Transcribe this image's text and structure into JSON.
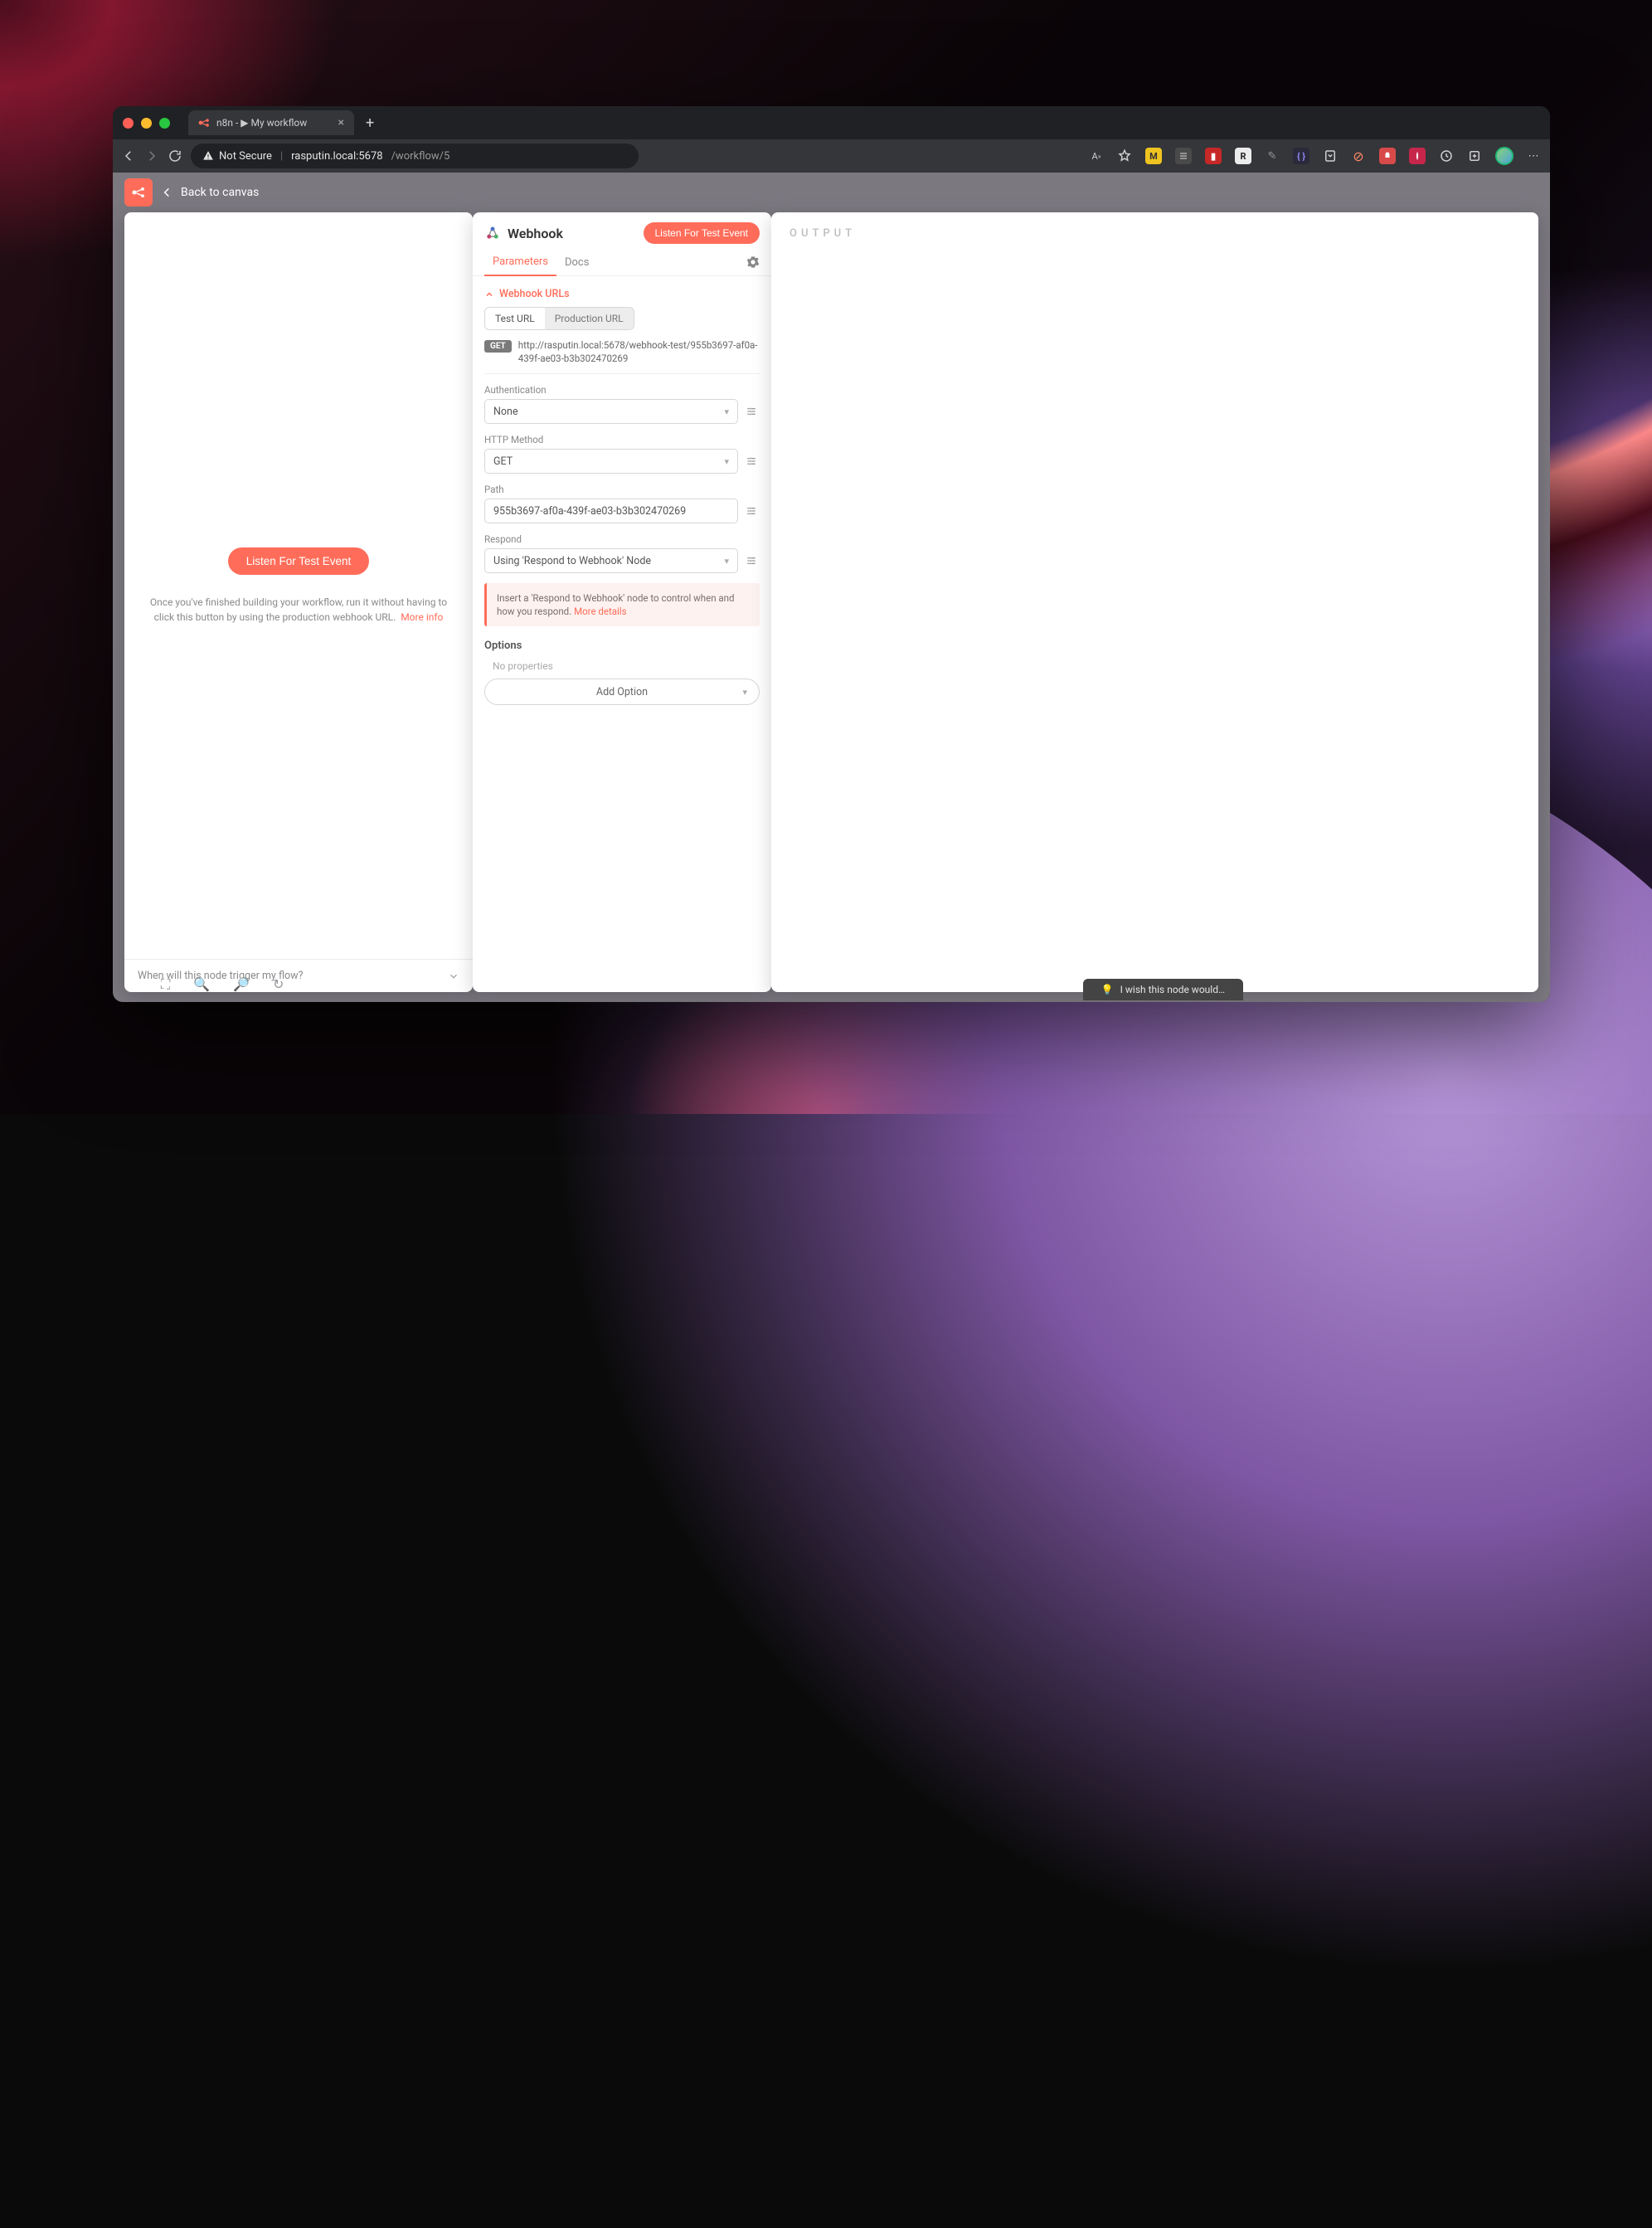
{
  "browser": {
    "tab": {
      "title": "n8n - ▶ My workflow"
    },
    "security_label": "Not Secure",
    "url_host": "rasputin.local",
    "url_port": "5678",
    "url_path": "/workflow/5"
  },
  "app": {
    "back_label": "Back to canvas",
    "output_heading": "OUTPUT",
    "feedback_prompt": "I wish this node would…"
  },
  "left": {
    "listen_label": "Listen For Test Event",
    "help_text": "Once you've finished building your workflow, run it without having to click this button by using the production webhook URL.",
    "help_more": "More info",
    "footer_question": "When will this node trigger my flow?"
  },
  "config": {
    "title": "Webhook",
    "listen_label": "Listen For Test Event",
    "tabs": {
      "parameters": "Parameters",
      "docs": "Docs"
    },
    "section_urls": "Webhook URLs",
    "url_mode": {
      "test": "Test URL",
      "prod": "Production URL"
    },
    "method_pill": "GET",
    "url_value": "http://rasputin.local:5678/webhook-test/955b3697-af0a-439f-ae03-b3b302470269",
    "fields": {
      "auth": {
        "label": "Authentication",
        "value": "None"
      },
      "method": {
        "label": "HTTP Method",
        "value": "GET"
      },
      "path": {
        "label": "Path",
        "value": "955b3697-af0a-439f-ae03-b3b302470269"
      },
      "respond": {
        "label": "Respond",
        "value": "Using 'Respond to Webhook' Node"
      }
    },
    "note_text": "Insert a 'Respond to Webhook' node to control when and how you respond.",
    "note_more": "More details",
    "options_heading": "Options",
    "no_properties": "No properties",
    "add_option": "Add Option"
  }
}
